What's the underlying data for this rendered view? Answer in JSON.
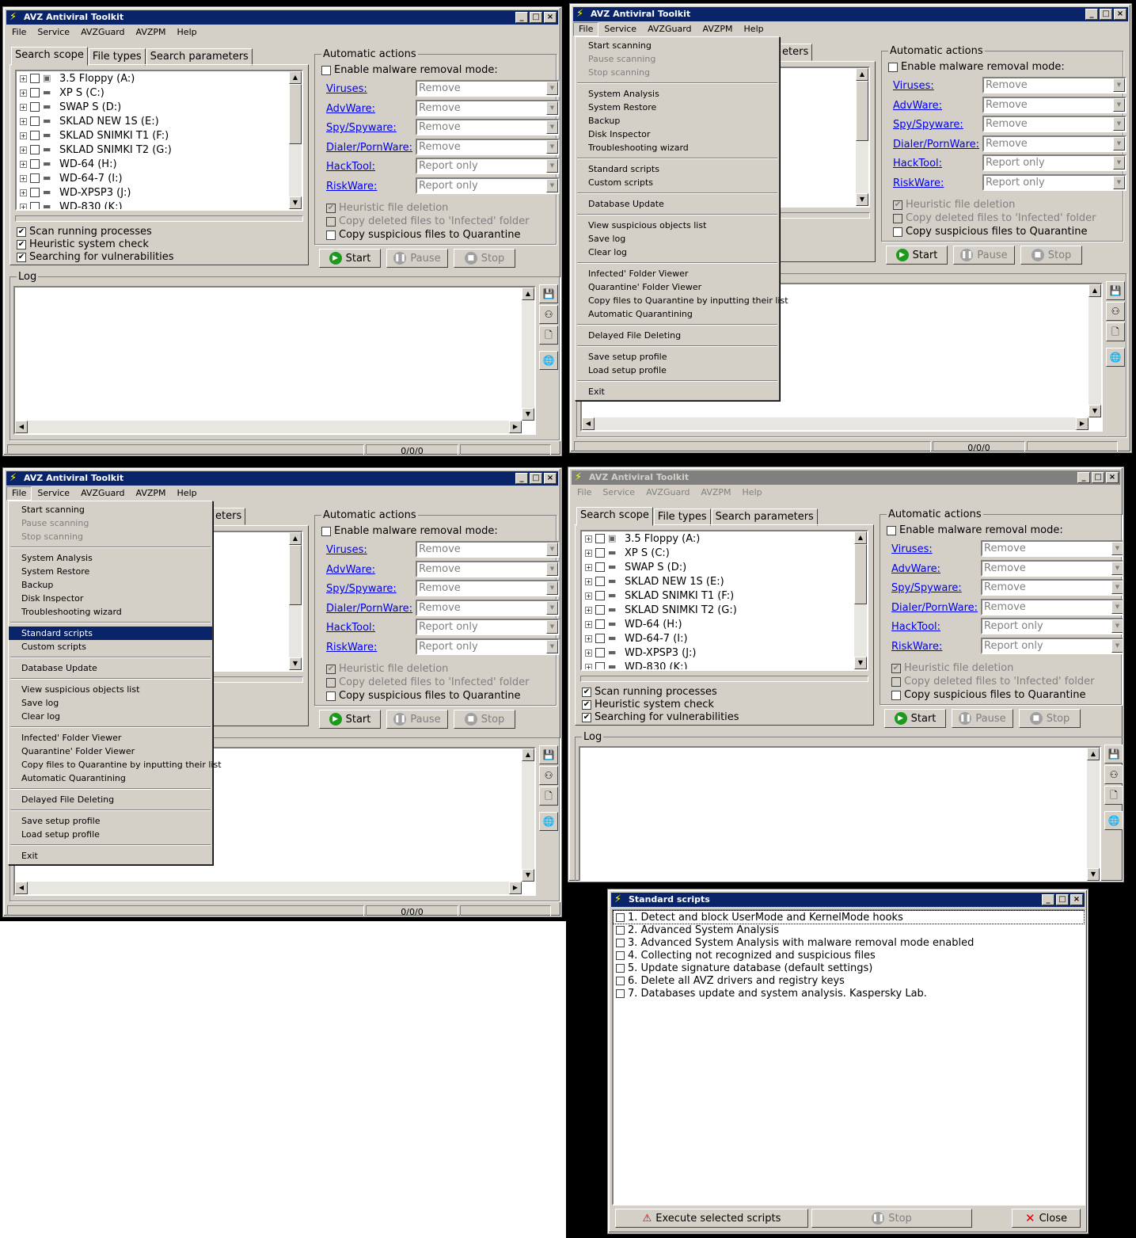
{
  "app": {
    "title": "AVZ Antiviral Toolkit",
    "menus": [
      "File",
      "Service",
      "AVZGuard",
      "AVZPM",
      "Help"
    ],
    "tabs": [
      "Search scope",
      "File types",
      "Search parameters"
    ],
    "tab_partial": "eters",
    "drives": [
      "3.5 Floppy (A:)",
      "XP S (C:)",
      "SWAP S (D:)",
      "SKLAD NEW 1S (E:)",
      "SKLAD SNIMKI T1 (F:)",
      "SKLAD SNIMKI T2 (G:)",
      "WD-64 (H:)",
      "WD-64-7 (I:)",
      "WD-XPSP3 (J:)",
      "WD-830 (K:)"
    ],
    "scan_options": [
      {
        "label": "Scan running processes",
        "checked": true
      },
      {
        "label": "Heuristic system check",
        "checked": true
      },
      {
        "label": "Searching for vulnerabilities",
        "checked": true
      }
    ],
    "auto_actions_title": "Automatic actions",
    "enable_removal": "Enable malware removal mode:",
    "threats": [
      {
        "label": "Viruses:",
        "action": "Remove"
      },
      {
        "label": "AdvWare:",
        "action": "Remove"
      },
      {
        "label": "Spy/Spyware:",
        "action": "Remove"
      },
      {
        "label": "Dialer/PornWare:",
        "action": "Remove"
      },
      {
        "label": "HackTool:",
        "action": "Report only"
      },
      {
        "label": "RiskWare:",
        "action": "Report only"
      }
    ],
    "heuristic_deletion": "Heuristic file deletion",
    "copy_deleted": "Copy deleted files to 'Infected' folder",
    "copy_suspicious": "Copy suspicious files to Quarantine",
    "buttons": {
      "start": "Start",
      "pause": "Pause",
      "stop": "Stop"
    },
    "log_label": "Log",
    "status_counts": "0/0/0"
  },
  "file_menu": [
    {
      "label": "Start scanning",
      "disabled": false
    },
    {
      "label": "Pause scanning",
      "disabled": true
    },
    {
      "label": "Stop scanning",
      "disabled": true
    },
    {
      "sep": true
    },
    {
      "label": "System Analysis"
    },
    {
      "label": "System Restore"
    },
    {
      "label": "Backup"
    },
    {
      "label": "Disk Inspector"
    },
    {
      "label": "Troubleshooting wizard"
    },
    {
      "sep": true
    },
    {
      "label": "Standard scripts"
    },
    {
      "label": "Custom scripts"
    },
    {
      "sep": true
    },
    {
      "label": "Database Update"
    },
    {
      "sep": true
    },
    {
      "label": "View suspicious objects list"
    },
    {
      "label": "Save log"
    },
    {
      "label": "Clear log"
    },
    {
      "sep": true
    },
    {
      "label": "Infected' Folder Viewer"
    },
    {
      "label": "Quarantine' Folder Viewer"
    },
    {
      "label": "Copy files to Quarantine by inputting their list"
    },
    {
      "label": "Automatic Quarantining"
    },
    {
      "sep": true
    },
    {
      "label": "Delayed File Deleting"
    },
    {
      "sep": true
    },
    {
      "label": "Save setup profile"
    },
    {
      "label": "Load setup profile"
    },
    {
      "sep": true
    },
    {
      "label": "Exit"
    }
  ],
  "scripts_dialog": {
    "title": "Standard scripts",
    "items": [
      "1. Detect and block UserMode and KernelMode hooks",
      "2. Advanced System Analysis",
      "3. Advanced System Analysis with malware removal mode enabled",
      "4. Collecting not recognized and suspicious files",
      "5. Update signature database (default settings)",
      "6. Delete all AVZ drivers and registry keys",
      "7. Databases update and system analysis. Kaspersky Lab."
    ],
    "execute": "Execute selected scripts",
    "stop": "Stop",
    "close": "Close"
  }
}
